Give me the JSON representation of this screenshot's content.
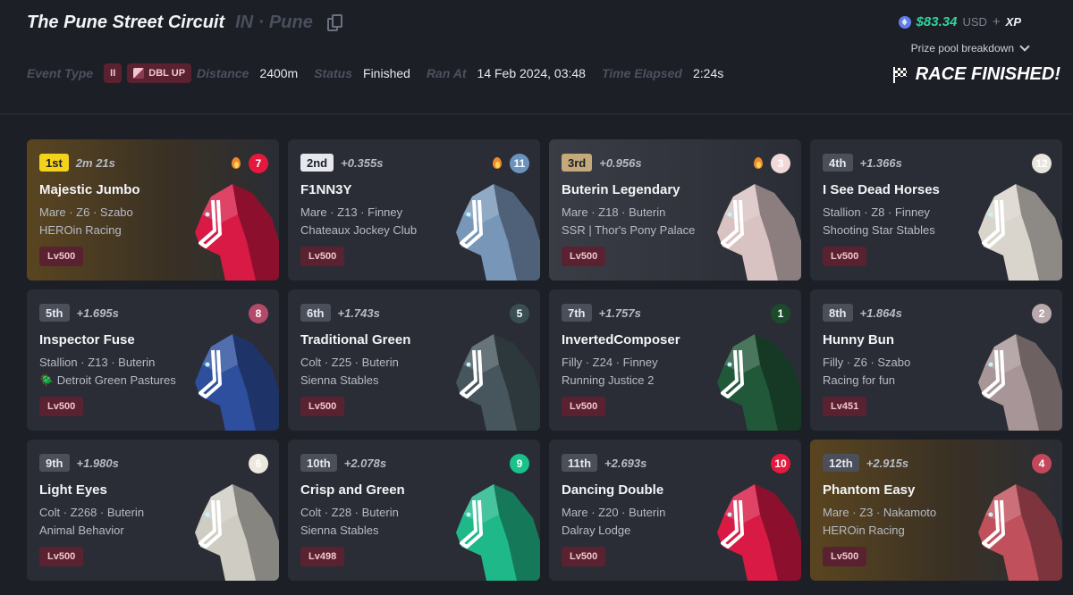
{
  "header": {
    "title": "The Pune Street Circuit",
    "location": "IN · Pune",
    "meta": {
      "event_type_label": "Event Type",
      "chip_pause": "II",
      "chip_dbl": "DBL UP",
      "distance_label": "Distance",
      "distance_value": "2400m",
      "status_label": "Status",
      "status_value": "Finished",
      "ran_at_label": "Ran At",
      "ran_at_value": "14 Feb 2024, 03:48",
      "time_elapsed_label": "Time Elapsed",
      "time_elapsed_value": "2:24s"
    },
    "prize": {
      "amount": "$83.34",
      "unit": "USD",
      "plus": "+",
      "xp": "XP",
      "breakdown_label": "Prize pool breakdown"
    },
    "race_status": "RACE FINISHED!"
  },
  "colors": {
    "accent_green": "#2fd49a",
    "level_bg": "#5a2230",
    "first_place": "#f2d21a"
  },
  "results": [
    {
      "pos": "1st",
      "gap": "2m 21s",
      "gate": "7",
      "gate_color": "#e5193e",
      "fire": true,
      "name": "Majestic Jumbo",
      "attrs": "Mare · Z6 · Szabo",
      "stable": "HEROin Racing",
      "level": "Lv500",
      "horse_color": "#d81a45",
      "style": "gold"
    },
    {
      "pos": "2nd",
      "gap": "+0.355s",
      "gate": "11",
      "gate_color": "#6a93bd",
      "fire": true,
      "name": "F1NN3Y",
      "attrs": "Mare · Z13 · Finney",
      "stable": "Chateaux Jockey Club",
      "level": "Lv500",
      "horse_color": "#7896b8",
      "style": ""
    },
    {
      "pos": "3rd",
      "gap": "+0.956s",
      "gate": "3",
      "gate_color": "#f2d9d9",
      "fire": true,
      "name": "Buterin Legendary",
      "attrs": "Mare · Z18 · Buterin",
      "stable": "SSR | Thor's Pony Palace",
      "level": "Lv500",
      "horse_color": "#d8c2c2",
      "style": "bronze"
    },
    {
      "pos": "4th",
      "gap": "+1.366s",
      "gate": "12",
      "gate_color": "#e9e5dc",
      "fire": false,
      "name": "I See Dead Horses",
      "attrs": "Stallion · Z8 · Finney",
      "stable": "Shooting Star Stables",
      "level": "Lv500",
      "horse_color": "#d9d5cc",
      "style": ""
    },
    {
      "pos": "5th",
      "gap": "+1.695s",
      "gate": "8",
      "gate_color": "#b34a6a",
      "fire": false,
      "name": "Inspector Fuse",
      "attrs": "Stallion · Z13 · Buterin",
      "stable": "🪲 Detroit Green Pastures",
      "level": "Lv500",
      "horse_color": "#2e4f9e",
      "style": ""
    },
    {
      "pos": "6th",
      "gap": "+1.743s",
      "gate": "5",
      "gate_color": "#3a4f54",
      "fire": false,
      "name": "Traditional Green",
      "attrs": "Colt · Z25 · Buterin",
      "stable": "Sienna Stables",
      "level": "Lv500",
      "horse_color": "#46565c",
      "style": ""
    },
    {
      "pos": "7th",
      "gap": "+1.757s",
      "gate": "1",
      "gate_color": "#1e4a2c",
      "fire": false,
      "name": "InvertedComposer",
      "attrs": "Filly · Z24 · Finney",
      "stable": "Running Justice 2",
      "level": "Lv500",
      "horse_color": "#22583a",
      "style": ""
    },
    {
      "pos": "8th",
      "gap": "+1.864s",
      "gate": "2",
      "gate_color": "#b9a9ad",
      "fire": false,
      "name": "Hunny Bun",
      "attrs": "Filly · Z6 · Szabo",
      "stable": "Racing for fun",
      "level": "Lv451",
      "horse_color": "#a89597",
      "style": ""
    },
    {
      "pos": "9th",
      "gap": "+1.980s",
      "gate": "6",
      "gate_color": "#ebe8e0",
      "fire": false,
      "name": "Light Eyes",
      "attrs": "Colt · Z268 · Buterin",
      "stable": "Animal Behavior",
      "level": "Lv500",
      "horse_color": "#cfccc4",
      "style": ""
    },
    {
      "pos": "10th",
      "gap": "+2.078s",
      "gate": "9",
      "gate_color": "#19c28a",
      "fire": false,
      "name": "Crisp and Green",
      "attrs": "Colt · Z28 · Buterin",
      "stable": "Sienna Stables",
      "level": "Lv498",
      "horse_color": "#1fb889",
      "style": ""
    },
    {
      "pos": "11th",
      "gap": "+2.693s",
      "gate": "10",
      "gate_color": "#e5193e",
      "fire": false,
      "name": "Dancing Double",
      "attrs": "Mare · Z20 · Buterin",
      "stable": "Dalray Lodge",
      "level": "Lv500",
      "horse_color": "#d81a45",
      "style": ""
    },
    {
      "pos": "12th",
      "gap": "+2.915s",
      "gate": "4",
      "gate_color": "#c4485a",
      "fire": false,
      "name": "Phantom Easy",
      "attrs": "Mare · Z3 · Nakamoto",
      "stable": "HEROin Racing",
      "level": "Lv500",
      "horse_color": "#c0505c",
      "style": "last"
    }
  ]
}
